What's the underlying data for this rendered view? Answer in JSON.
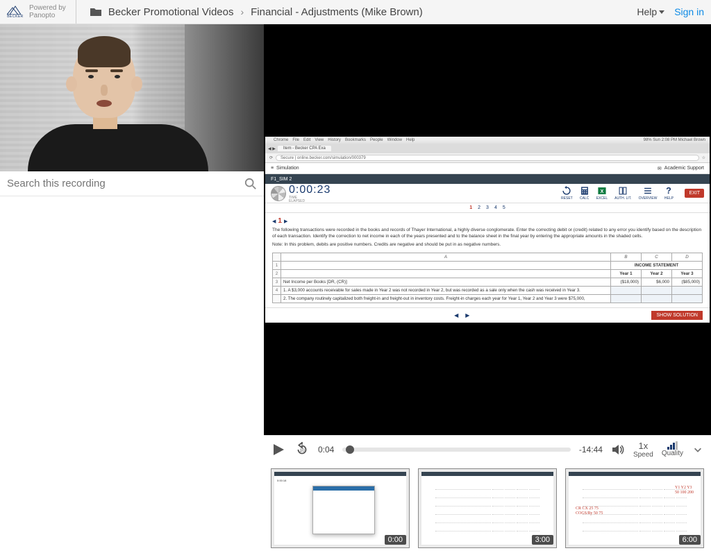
{
  "header": {
    "logo_text": "BECKER",
    "powered_line1": "Powered by",
    "powered_line2": "Panopto",
    "breadcrumb_folder": "Becker Promotional Videos",
    "breadcrumb_title": "Financial - Adjustments (Mike Brown)",
    "help": "Help",
    "signin": "Sign in"
  },
  "search": {
    "placeholder": "Search this recording"
  },
  "slide": {
    "mac_menu": [
      "Chrome",
      "File",
      "Edit",
      "View",
      "History",
      "Bookmarks",
      "People",
      "Window",
      "Help"
    ],
    "mac_right": "98%  Sun 2:08 PM  Michael Brown",
    "browser_tab": "Item - Becker CPA Exa",
    "url": "Secure | online.becker.com/simulation/000379",
    "appbar_title": "Simulation",
    "appbar_support": "Academic Support",
    "sim_title": "F1_SIM 2",
    "timer": "0:00:23",
    "timer_label1": "TIME",
    "timer_label2": "ELAPSED",
    "tools": [
      {
        "label": "RESET",
        "icon": "reset"
      },
      {
        "label": "CALC",
        "icon": "calc"
      },
      {
        "label": "EXCEL",
        "icon": "excel"
      },
      {
        "label": "AUTH. LIT.",
        "icon": "book"
      },
      {
        "label": "OVERVIEW",
        "icon": "list"
      },
      {
        "label": "HELP",
        "icon": "help"
      }
    ],
    "exit": "EXIT",
    "pager": [
      "1",
      "2",
      "3",
      "4",
      "5"
    ],
    "qnum": "1",
    "question_text": "The following transactions were recorded in the books and records of Thayer International, a highly diverse conglomerate. Enter the correcting debit or (credit) related to any error you identify based on the description of each transaction. Identify the correction to net income in each of the years presented and to the balance sheet in the final year by entering the appropriate amounts in the shaded cells.",
    "question_note": "Note: In this problem, debits are positive numbers. Credits are negative and should be put in as negative numbers.",
    "col_letters": [
      "A",
      "B",
      "C",
      "D"
    ],
    "section_header": "INCOME STATEMENT",
    "year_headers": [
      "Year 1",
      "Year 2",
      "Year 3"
    ],
    "row_netincome_label": "Net Income per Books [DR, (CR)]",
    "row_netincome_vals": [
      "($18,000)",
      "$6,000",
      "($85,000)"
    ],
    "row_item1": "1. A $3,000 accounts receivable for sales made in Year 2 was not recorded in Year 2, but was recorded as a sale only when the cash was received in Year 3.",
    "row_item2": "2. The company routinely capitalized both freight-in and freight-out in inventory costs. Freight-in charges each year for Year 1, Year 2 and Year 3 were $75,000,",
    "show_solution": "SHOW SOLUTION"
  },
  "controls": {
    "current_time": "0:04",
    "remaining": "-14:44",
    "speed_value": "1x",
    "speed_label": "Speed",
    "quality_label": "Quality"
  },
  "thumbs": [
    {
      "time": "0:00"
    },
    {
      "time": "3:00"
    },
    {
      "time": "6:00"
    }
  ]
}
